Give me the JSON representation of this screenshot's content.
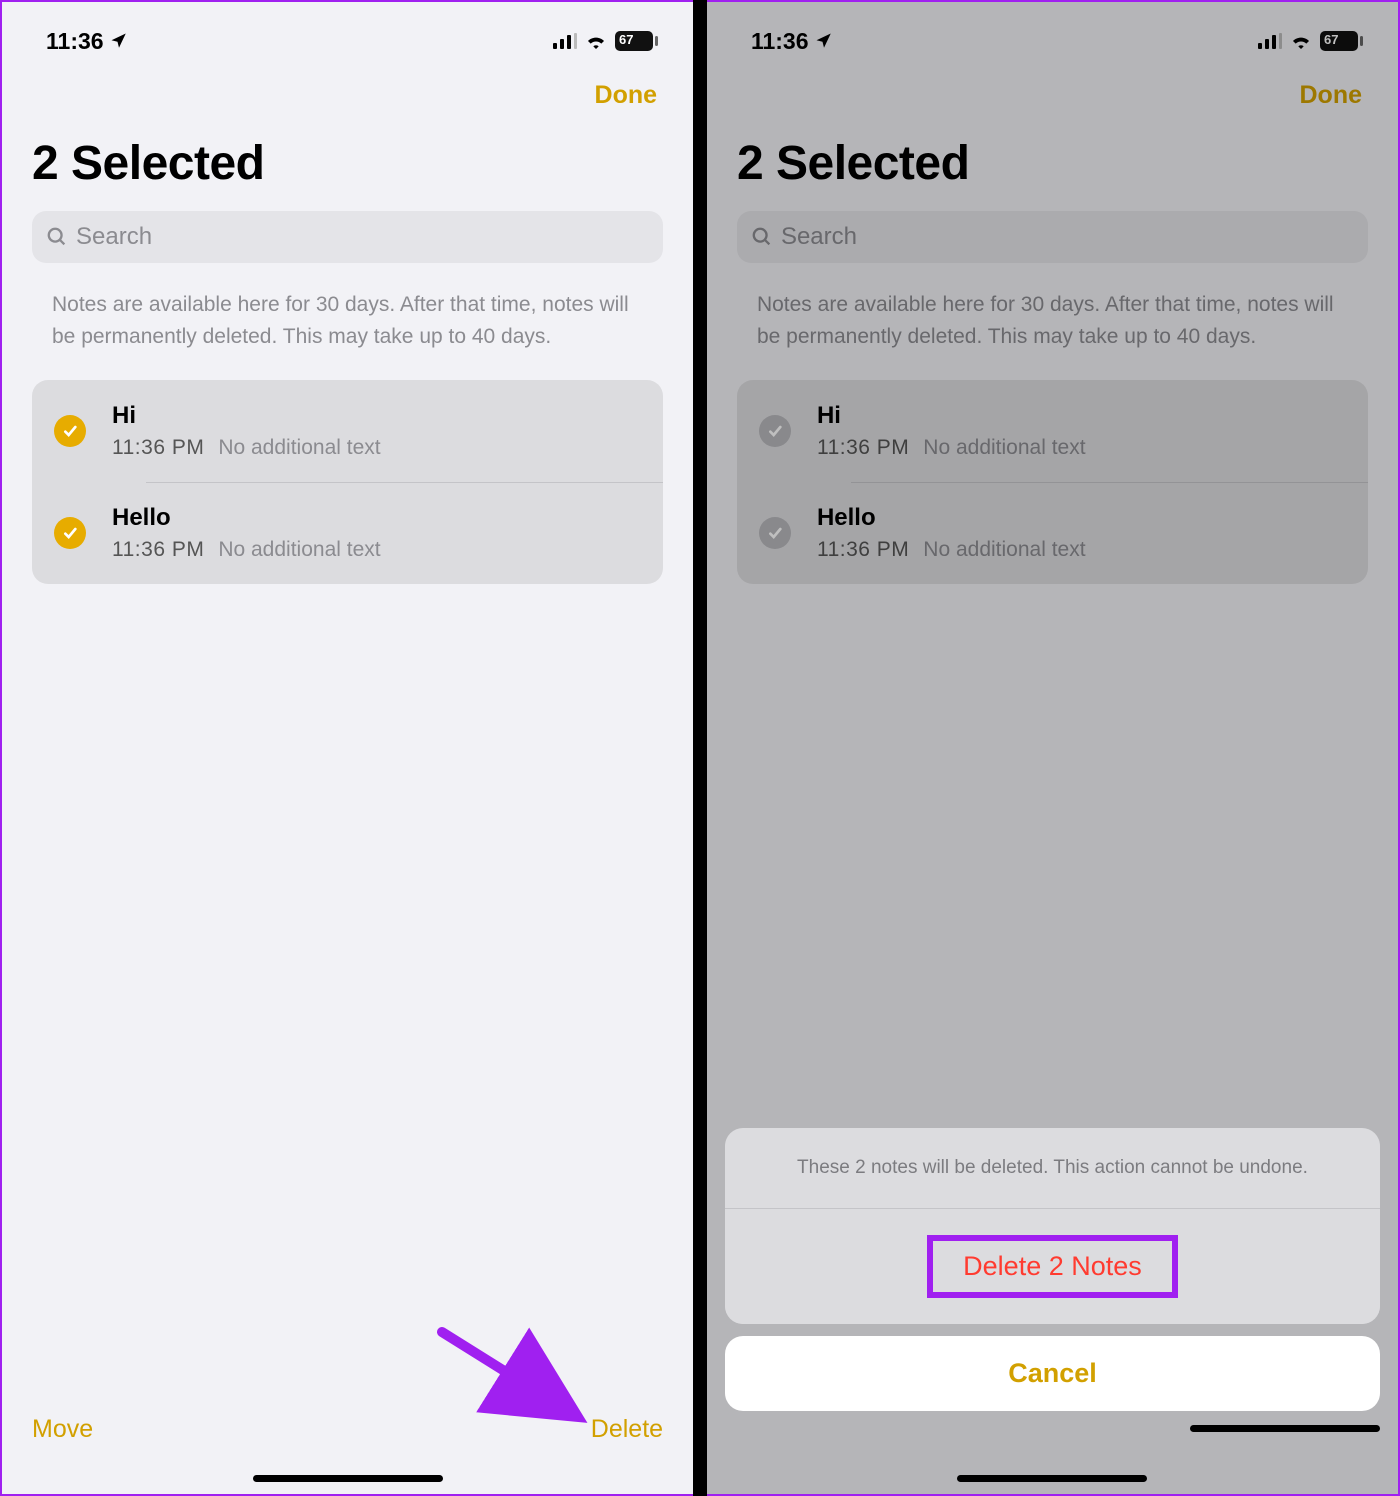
{
  "status": {
    "time": "11:36",
    "battery": "67"
  },
  "nav": {
    "done": "Done"
  },
  "title": "2 Selected",
  "search": {
    "placeholder": "Search"
  },
  "hint": "Notes are available here for 30 days. After that time, notes will be permanently deleted. This may take up to 40 days.",
  "notes": [
    {
      "title": "Hi",
      "time": "11:36 PM",
      "preview": "No additional text"
    },
    {
      "title": "Hello",
      "time": "11:36 PM",
      "preview": "No additional text"
    }
  ],
  "toolbar": {
    "move": "Move",
    "delete": "Delete"
  },
  "sheet": {
    "message": "These 2 notes will be deleted. This action cannot be undone.",
    "delete": "Delete 2 Notes",
    "cancel": "Cancel"
  }
}
